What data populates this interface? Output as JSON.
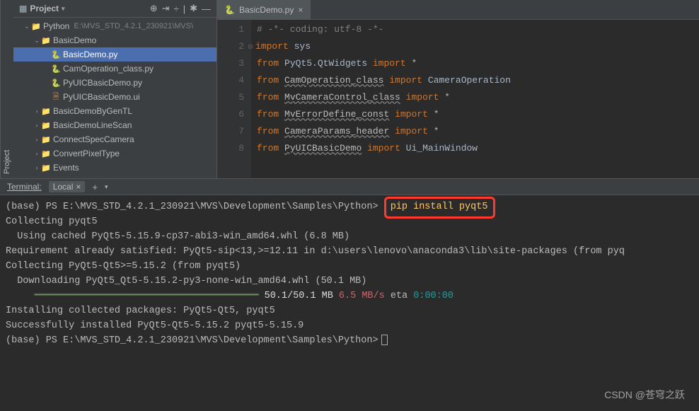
{
  "sidebar_tabs": [
    "Project"
  ],
  "project": {
    "title": "Project",
    "toolbar_icons": [
      "target-icon",
      "collapse-all-icon",
      "expand-icon",
      "divider",
      "settings-icon",
      "hide-icon"
    ],
    "tree": [
      {
        "indent": 1,
        "arrow": "v",
        "icon": "folder",
        "label": "Python",
        "path": "E:\\MVS_STD_4.2.1_230921\\MVS\\",
        "selected": false
      },
      {
        "indent": 2,
        "arrow": "v",
        "icon": "folder",
        "label": "BasicDemo",
        "selected": false
      },
      {
        "indent": 3,
        "arrow": "",
        "icon": "python",
        "label": "BasicDemo.py",
        "selected": true
      },
      {
        "indent": 3,
        "arrow": "",
        "icon": "python",
        "label": "CamOperation_class.py",
        "selected": false
      },
      {
        "indent": 3,
        "arrow": "",
        "icon": "python",
        "label": "PyUICBasicDemo.py",
        "selected": false
      },
      {
        "indent": 3,
        "arrow": "",
        "icon": "ui",
        "label": "PyUICBasicDemo.ui",
        "selected": false
      },
      {
        "indent": 2,
        "arrow": ">",
        "icon": "folder",
        "label": "BasicDemoByGenTL",
        "selected": false
      },
      {
        "indent": 2,
        "arrow": ">",
        "icon": "folder",
        "label": "BasicDemoLineScan",
        "selected": false
      },
      {
        "indent": 2,
        "arrow": ">",
        "icon": "folder",
        "label": "ConnectSpecCamera",
        "selected": false
      },
      {
        "indent": 2,
        "arrow": ">",
        "icon": "folder",
        "label": "ConvertPixelType",
        "selected": false
      },
      {
        "indent": 2,
        "arrow": ">",
        "icon": "folder",
        "label": "Events",
        "selected": false
      }
    ]
  },
  "editor": {
    "tab": {
      "icon": "python",
      "label": "BasicDemo.py"
    },
    "lines": [
      {
        "n": 1,
        "tokens": [
          [
            "cm",
            "# -*- coding: utf-8 -*-"
          ]
        ]
      },
      {
        "n": 2,
        "tokens": [
          [
            "kw",
            "import"
          ],
          [
            "fn",
            " sys"
          ]
        ]
      },
      {
        "n": 3,
        "tokens": [
          [
            "kw",
            "from"
          ],
          [
            "fn",
            " PyQt5.QtWidgets "
          ],
          [
            "kw",
            "import"
          ],
          [
            "fn",
            " *"
          ]
        ]
      },
      {
        "n": 4,
        "tokens": [
          [
            "kw",
            "from"
          ],
          [
            "fn",
            " "
          ],
          [
            "und",
            "CamOperation_class"
          ],
          [
            "fn",
            " "
          ],
          [
            "kw",
            "import"
          ],
          [
            "fn",
            " CameraOperation"
          ]
        ]
      },
      {
        "n": 5,
        "tokens": [
          [
            "kw",
            "from"
          ],
          [
            "fn",
            " "
          ],
          [
            "und",
            "MvCameraControl_class"
          ],
          [
            "fn",
            " "
          ],
          [
            "kw",
            "import"
          ],
          [
            "fn",
            " *"
          ]
        ]
      },
      {
        "n": 6,
        "tokens": [
          [
            "kw",
            "from"
          ],
          [
            "fn",
            " "
          ],
          [
            "und",
            "MvErrorDefine_const"
          ],
          [
            "fn",
            " "
          ],
          [
            "kw",
            "import"
          ],
          [
            "fn",
            " *"
          ]
        ]
      },
      {
        "n": 7,
        "tokens": [
          [
            "kw",
            "from"
          ],
          [
            "fn",
            " "
          ],
          [
            "und",
            "CameraParams_header"
          ],
          [
            "fn",
            " "
          ],
          [
            "kw",
            "import"
          ],
          [
            "fn",
            " *"
          ]
        ]
      },
      {
        "n": 8,
        "tokens": [
          [
            "kw",
            "from"
          ],
          [
            "fn",
            " "
          ],
          [
            "und",
            "PyUICBasicDemo"
          ],
          [
            "fn",
            " "
          ],
          [
            "kw",
            "import"
          ],
          [
            "fn",
            " Ui_MainWindow"
          ]
        ]
      }
    ]
  },
  "terminal": {
    "title": "Terminal:",
    "tab": "Local",
    "prompt_prefix": "(base) PS E:\\MVS_STD_4.2.1_230921\\MVS\\Development\\Samples\\Python>",
    "command": "pip install pyqt5",
    "lines": {
      "collecting1": "Collecting pyqt5",
      "cached": "  Using cached PyQt5-5.15.9-cp37-abi3-win_amd64.whl (6.8 MB)",
      "satisfied": "Requirement already satisfied: PyQt5-sip<13,>=12.11 in d:\\users\\lenovo\\anaconda3\\lib\\site-packages (from pyq",
      "collecting2": "Collecting PyQt5-Qt5>=5.15.2 (from pyqt5)",
      "downloading": "  Downloading PyQt5_Qt5-5.15.2-py3-none-win_amd64.whl (50.1 MB)",
      "progress_bar": "     ━━━━━━━━━━━━━━━━━━━━━━━━━━━━━━━━━━━━━━━",
      "progress_text": " 50.1/50.1 MB",
      "progress_speed": " 6.5 MB/s",
      "progress_eta_label": " eta",
      "progress_eta": " 0:00:00",
      "installing": "Installing collected packages: PyQt5-Qt5, pyqt5",
      "success": "Successfully installed PyQt5-Qt5-5.15.2 pyqt5-5.15.9"
    }
  },
  "watermark": "CSDN @苍穹之跃"
}
